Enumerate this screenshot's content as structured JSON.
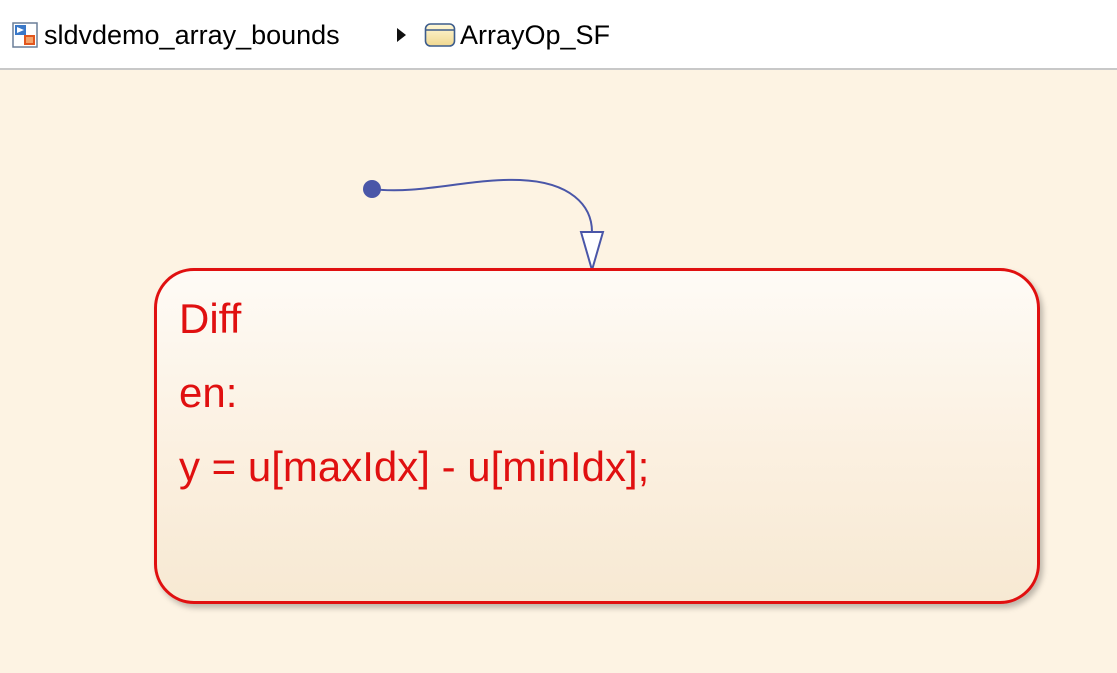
{
  "breadcrumb": {
    "model_name": "sldvdemo_array_bounds",
    "chart_name": "ArrayOp_SF",
    "model_icon": "simulink-model-icon",
    "chart_icon": "stateflow-chart-icon",
    "separator_icon": "right-triangle-icon"
  },
  "chart": {
    "state": {
      "name": "Diff",
      "entry_label": "en:",
      "action": "y = u[maxIdx] - u[minIdx];"
    },
    "colors": {
      "canvas_background": "#fdf3e3",
      "state_border": "#e01010",
      "state_text": "#e01010",
      "transition": "#4a56a8"
    }
  }
}
